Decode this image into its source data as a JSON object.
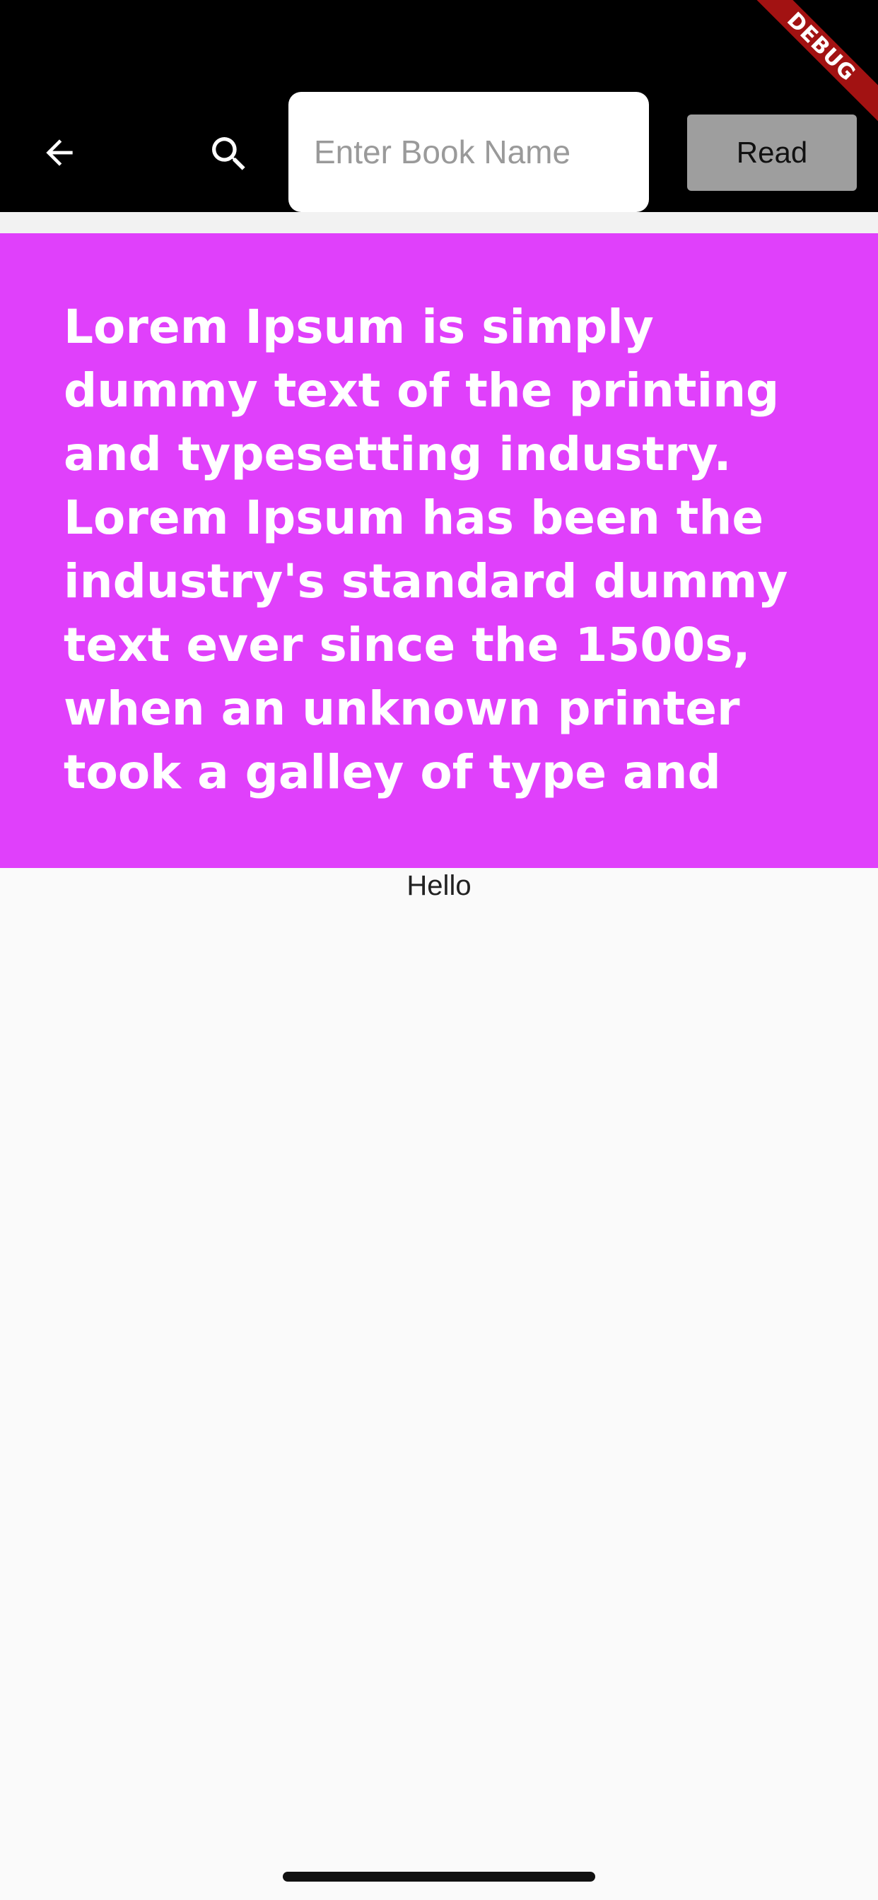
{
  "appbar": {
    "back_icon": "arrow-back-icon",
    "search_icon": "search-icon",
    "search_placeholder": "Enter Book Name",
    "search_value": "",
    "read_label": "Read",
    "debug_label": "DEBUG"
  },
  "content": {
    "paragraph": "Lorem Ipsum is simply dummy text of the printing and typesetting industry. Lorem Ipsum has been the industry's standard dummy text ever since the 1500s, when an unknown printer took a galley of type and",
    "caption": "Hello"
  },
  "colors": {
    "appbar_bg": "#000000",
    "panel_bg": "#e040fb",
    "button_bg": "#9e9e9e",
    "debug_banner": "#a21212"
  }
}
